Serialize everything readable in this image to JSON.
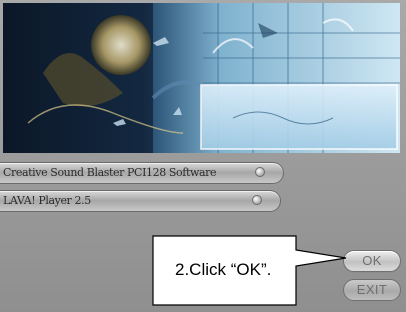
{
  "options": [
    {
      "label": "Creative Sound Blaster PCI128 Software"
    },
    {
      "label": "LAVA! Player 2.5"
    }
  ],
  "buttons": {
    "ok_label": "OK",
    "exit_label": "EXIT"
  },
  "callout": {
    "text": "2.Click “OK”."
  }
}
